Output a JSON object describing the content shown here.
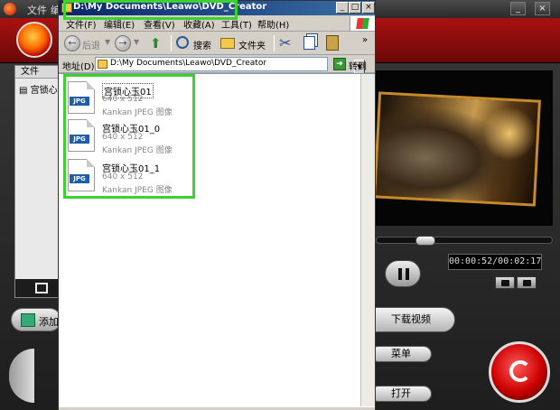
{
  "background_app": {
    "menu_file": "文件",
    "menu_second": "编",
    "left_panel": {
      "column_header": "文件",
      "row_label": "宫锁心"
    },
    "add_button_label": "添加",
    "timecode": "00:00:52/00:02:17",
    "download_video_label": "下载视频",
    "menu_button_label": "菜单",
    "open_button_label": "打开"
  },
  "explorer": {
    "title": "D:\\My Documents\\Leawo\\DVD_Creator",
    "menubar": {
      "file": "文件(F)",
      "edit": "编辑(E)",
      "view": "查看(V)",
      "favorites": "收藏(A)",
      "tools": "工具(T)",
      "help": "帮助(H)"
    },
    "toolbar": {
      "back_label": "后退",
      "search_label": "搜索",
      "folders_label": "文件夹",
      "more_chevron": "»"
    },
    "address": {
      "label": "地址(D)",
      "value": "D:\\My Documents\\Leawo\\DVD_Creator",
      "go_label": "转到"
    },
    "files": [
      {
        "name": "宫锁心玉01",
        "dimensions": "640 x 512",
        "type": "Kankan JPEG 图像",
        "badge": "JPG"
      },
      {
        "name": "宫锁心玉01_0",
        "dimensions": "640 x 512",
        "type": "Kankan JPEG 图像",
        "badge": "JPG"
      },
      {
        "name": "宫锁心玉01_1",
        "dimensions": "640 x 512",
        "type": "Kankan JPEG 图像",
        "badge": "JPG"
      }
    ]
  },
  "colors": {
    "highlight": "#3bd22f",
    "explorer_titlebar": "#0a246a",
    "app_header": "#a11111"
  }
}
